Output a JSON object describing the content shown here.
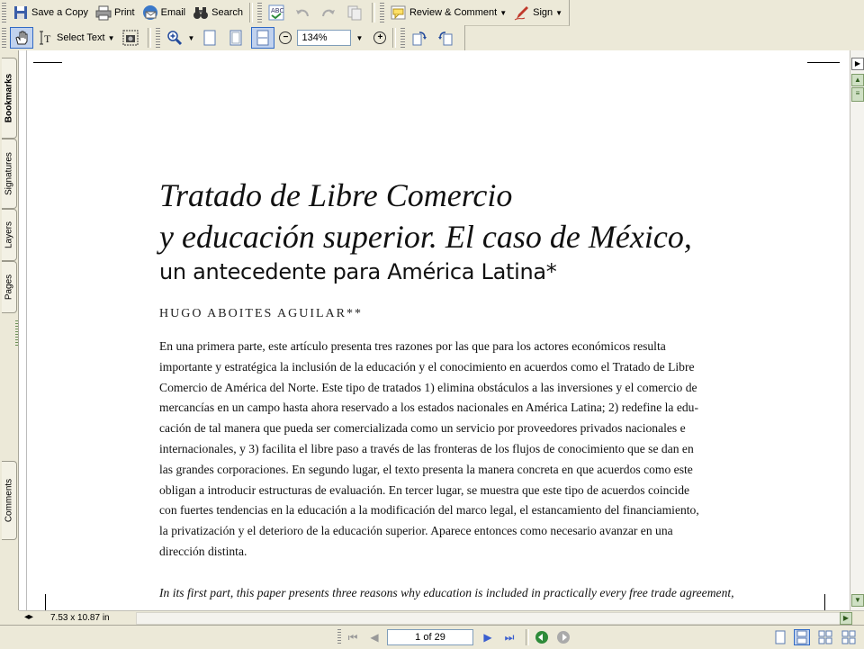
{
  "toolbar1": {
    "save_copy_label": "Save a Copy",
    "print_label": "Print",
    "email_label": "Email",
    "search_label": "Search",
    "review_label": "Review & Comment",
    "sign_label": "Sign"
  },
  "toolbar2": {
    "select_text_label": "Select Text",
    "zoom_value": "134%"
  },
  "nav_tabs": {
    "bookmarks": "Bookmarks",
    "signatures": "Signatures",
    "layers": "Layers",
    "pages": "Pages",
    "comments": "Comments"
  },
  "document": {
    "title_line1": "Tratado de Libre Comercio",
    "title_line2": "y educación superior. El caso de México,",
    "subtitle": "un antecedente para América Latina*",
    "author": "HUGO ABOITES AGUILAR**",
    "abstract_es_lines": [
      "En una primera parte, este artículo presenta tres razones por las que para los actores económicos resulta",
      "importante y estratégica la inclusión de la educación y el conocimiento en acuerdos como el Tratado de Libre",
      "Comercio de América del Norte. Este tipo de tratados 1) elimina obstáculos a las inversiones y el comercio de",
      "mercancías en un campo hasta ahora reservado a los estados nacionales en América Latina; 2) redefine la edu-",
      "cación de tal manera que pueda ser comercializada como un servicio por proveedores privados nacionales e",
      "internacionales, y 3) facilita el libre paso a través de las fronteras de los flujos de conocimiento que se dan en",
      "las grandes corporaciones. En segundo lugar, el texto presenta la manera concreta en que acuerdos como este",
      "obligan a introducir estructuras de evaluación. En tercer lugar, se muestra que este tipo de acuerdos coincide",
      "con fuertes tendencias en la educación a la modificación del marco legal, el estancamiento del financiamiento,",
      "la privatización y el deterioro de la educación superior. Aparece entonces como necesario avanzar en una",
      "dirección distinta."
    ],
    "abstract_en_line1": "In its first part, this paper presents three reasons why education is included in practically every free trade agreement,"
  },
  "status": {
    "page_size": "7.53 x 10.87 in"
  },
  "page_nav": {
    "page_indicator": "1 of 29"
  },
  "colors": {
    "chrome": "#ece9d8",
    "accent_blue": "#316ac5",
    "nav_green": "#2e8b3a"
  }
}
